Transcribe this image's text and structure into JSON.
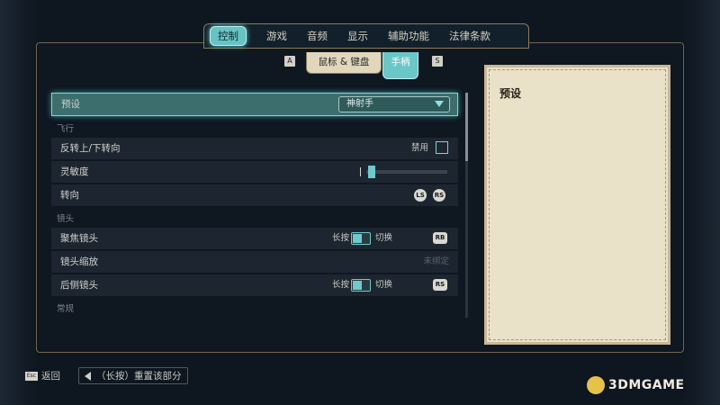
{
  "background": {
    "corner_tab": ""
  },
  "top_tabs": [
    {
      "label": "控制",
      "active": true
    },
    {
      "label": "游戏",
      "active": false
    },
    {
      "label": "音频",
      "active": false
    },
    {
      "label": "显示",
      "active": false
    },
    {
      "label": "辅助功能",
      "active": false
    },
    {
      "label": "法律条款",
      "active": false
    }
  ],
  "sub_tabs": {
    "left_key": "A",
    "right_key": "S",
    "mouse_keyboard": "鼠标 & 键盘",
    "gamepad": "手柄",
    "gamepad_sub": "",
    "active": "gamepad"
  },
  "settings": {
    "preset": {
      "label": "预设",
      "value": "神射手"
    },
    "sections": {
      "flight": "飞行",
      "camera": "镜头",
      "general": "常规"
    },
    "invert_up_down": {
      "label": "反转上/下转向",
      "value_label": "禁用"
    },
    "sensitivity": {
      "label": "灵敏度",
      "level": 0.05
    },
    "turn": {
      "label": "转向",
      "button1": "LS",
      "button2": "RS"
    },
    "focus_camera": {
      "label": "聚焦镜头",
      "hold_label": "长按",
      "toggle_label": "切换",
      "button": "RB"
    },
    "camera_zoom": {
      "label": "镜头缩放",
      "value": "未绑定"
    },
    "rear_camera": {
      "label": "后侧镜头",
      "hold_label": "长按",
      "toggle_label": "切换",
      "button": "RS"
    }
  },
  "info_panel": {
    "title": "预设"
  },
  "bottom": {
    "esc_key": "Esc",
    "back_label": "返回",
    "reset_label": "（长按）重置该部分"
  },
  "watermark": "3DMGAME",
  "colors": {
    "accent": "#6bc6c8",
    "panel": "#e9e1c8",
    "frame_border": "#8a7c5a"
  }
}
